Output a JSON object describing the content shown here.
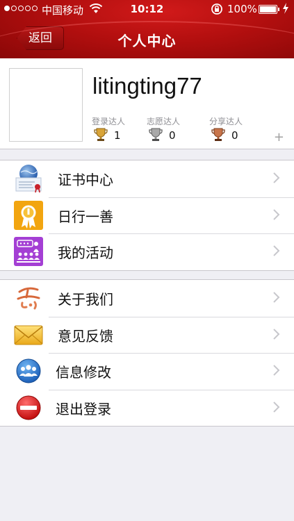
{
  "status_bar": {
    "carrier": "中国移动",
    "time": "10:12",
    "battery": "100%"
  },
  "nav": {
    "back_label": "返回",
    "title": "个人中心"
  },
  "profile": {
    "username": "litingting77",
    "badges": [
      {
        "label": "登录达人",
        "count": "1",
        "color": "#d9a437"
      },
      {
        "label": "志愿达人",
        "count": "0",
        "color": "#9a9a9a"
      },
      {
        "label": "分享达人",
        "count": "0",
        "color": "#c8744a"
      }
    ],
    "add_icon": "plus-icon"
  },
  "menu_group_1": [
    {
      "label": "证书中心",
      "icon": "certificate-icon"
    },
    {
      "label": "日行一善",
      "icon": "medal-icon"
    },
    {
      "label": "我的活动",
      "icon": "activity-icon"
    }
  ],
  "menu_group_2": [
    {
      "label": "关于我们",
      "icon": "logo-icon"
    },
    {
      "label": "意见反馈",
      "icon": "envelope-icon"
    },
    {
      "label": "信息修改",
      "icon": "users-icon"
    },
    {
      "label": "退出登录",
      "icon": "no-entry-icon"
    }
  ],
  "colors": {
    "header_red": "#b30f0f",
    "background": "#efeff4"
  }
}
